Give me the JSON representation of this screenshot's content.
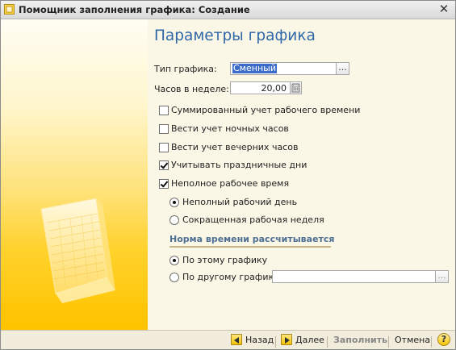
{
  "window": {
    "title": "Помощник заполнения графика: Создание"
  },
  "page": {
    "heading": "Параметры графика"
  },
  "form": {
    "schedule_type": {
      "label": "Тип графика:",
      "value": "Сменный"
    },
    "hours_per_week": {
      "label": "Часов в неделе:",
      "value": "20,00"
    },
    "checkboxes": [
      {
        "label": "Суммированный учет рабочего времени",
        "checked": false
      },
      {
        "label": "Вести учет ночных часов",
        "checked": false
      },
      {
        "label": "Вести учет вечерних часов",
        "checked": false
      },
      {
        "label": "Учитывать праздничные дни",
        "checked": true
      },
      {
        "label": "Неполное рабочее время",
        "checked": true
      }
    ],
    "parttime_options": [
      {
        "label": "Неполный рабочий день",
        "selected": true
      },
      {
        "label": "Сокращенная рабочая неделя",
        "selected": false
      }
    ],
    "norm_group": {
      "title": "Норма времени рассчитывается",
      "options": [
        {
          "label": "По этому графику",
          "selected": true
        },
        {
          "label": "По другому графику:",
          "selected": false
        }
      ],
      "other_schedule_value": ""
    }
  },
  "footer": {
    "back": "Назад",
    "next": "Далее",
    "fill": "Заполнить",
    "cancel": "Отмена",
    "help": "?"
  },
  "colors": {
    "heading": "#2f67a8",
    "accent_yellow": "#f5c200",
    "group_title": "#4d6f93"
  },
  "icons": [
    "app-icon",
    "close-icon",
    "calculator-icon",
    "ellipsis-icon",
    "back-arrow-icon",
    "next-arrow-icon",
    "help-icon",
    "calendar-illustration"
  ]
}
